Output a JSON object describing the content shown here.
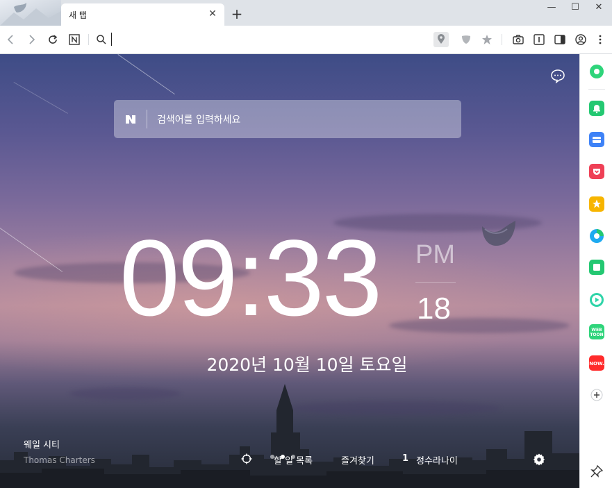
{
  "browser": {
    "tab": {
      "title": "새 탭"
    },
    "window_controls": {
      "minimize": "—",
      "maximize": "☐",
      "close": "✕"
    }
  },
  "newtab": {
    "search": {
      "placeholder": "검색어를 입력하세요",
      "logo": "N"
    },
    "clock": {
      "time": "09:33",
      "ampm": "PM",
      "seconds": "18"
    },
    "date": "2020년 10월 10일 토요일",
    "background": {
      "location": "웨일 시티",
      "credit": "Thomas Charters"
    },
    "bottom_bar": {
      "todo_label": "할 일 목록",
      "bookmarks_label": "즐겨찾기",
      "profile_count": "1",
      "profile_name": "정수라나이"
    },
    "carousel": {
      "count": 3,
      "active": 2
    }
  },
  "sidebar": {
    "apps": [
      "whale-green-icon",
      "bell-icon",
      "wallet-icon",
      "pocket-icon",
      "star-icon",
      "translate-icon",
      "memo-icon",
      "player-icon",
      "webtoon-icon",
      "now-icon",
      "add-icon"
    ],
    "webtoon_text": "WEB TOON",
    "now_text": "NOW."
  },
  "colors": {
    "sky_top": "#3e4c86",
    "sky_mid": "#b48c9f",
    "accent_green": "#2ed47a"
  }
}
